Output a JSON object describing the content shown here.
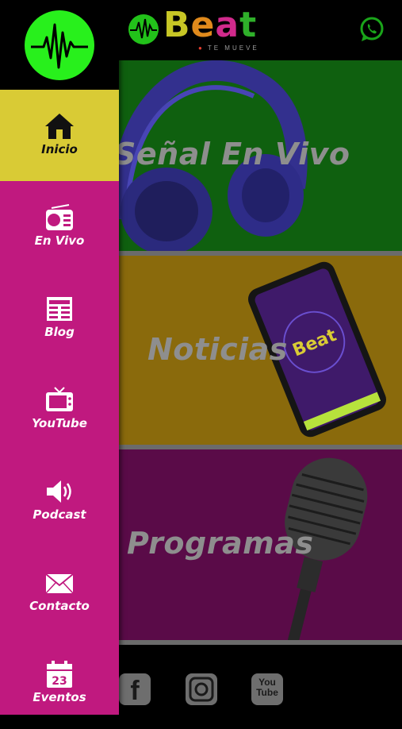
{
  "app": {
    "brand_word": "Beat",
    "brand_tagline": "TE MUEVE"
  },
  "colors": {
    "drawer_bg": "#c0197f",
    "active_item_bg": "#d9cb35",
    "logo_green": "#28f01c",
    "card_live_bg": "#0f600f",
    "card_news_bg": "#8a6a0c",
    "card_shows_bg": "#5a0b48"
  },
  "drawer": {
    "items": [
      {
        "label": "Inicio",
        "icon": "home-icon",
        "active": true
      },
      {
        "label": "En Vivo",
        "icon": "radio-icon"
      },
      {
        "label": "Blog",
        "icon": "newspaper-icon"
      },
      {
        "label": "YouTube",
        "icon": "tv-icon"
      },
      {
        "label": "Podcast",
        "icon": "speaker-icon"
      },
      {
        "label": "Contacto",
        "icon": "envelope-icon"
      },
      {
        "label": "Eventos",
        "icon": "calendar-icon",
        "calendar_day": "23"
      }
    ]
  },
  "cards": [
    {
      "title": "Señal En Vivo",
      "image": "headphones"
    },
    {
      "title": "Noticias",
      "image": "smartphone-with-beat-logo"
    },
    {
      "title": "Programas",
      "image": "microphone"
    }
  ],
  "phone_screen_word": "Beat",
  "social": {
    "facebook_label": "f",
    "youtube_label_top": "You",
    "youtube_label_bottom": "Tube"
  }
}
